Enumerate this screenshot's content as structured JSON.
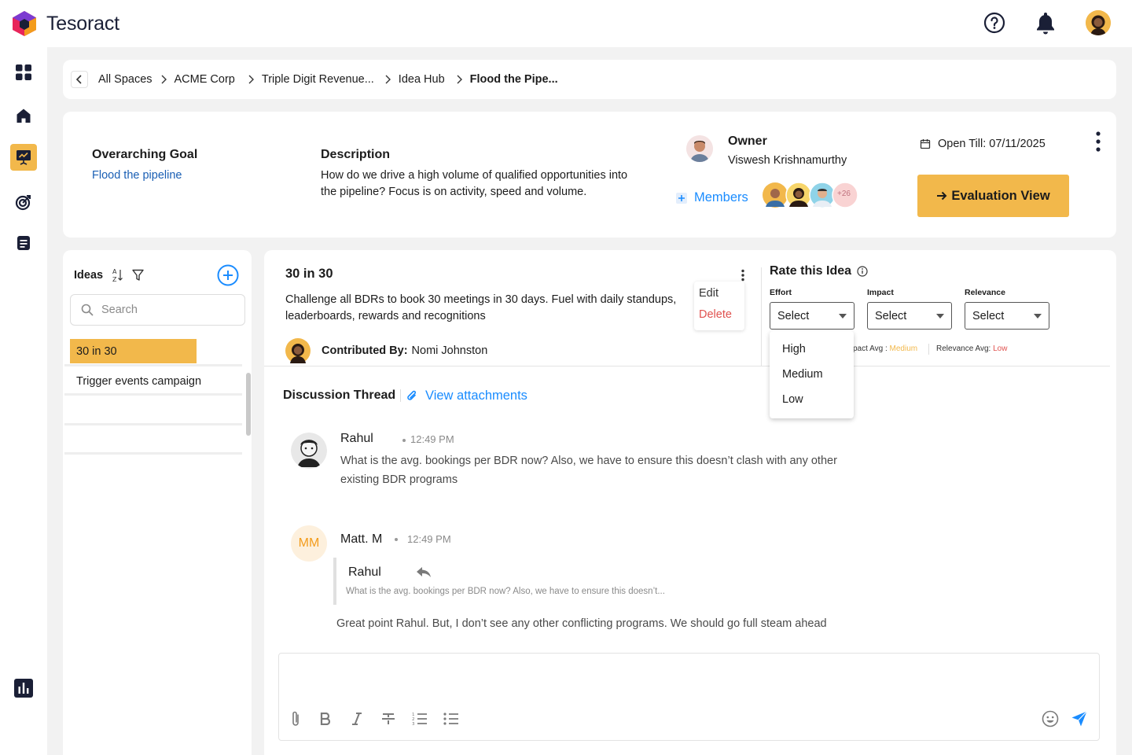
{
  "app": {
    "name": "Tesoract"
  },
  "breadcrumb": {
    "items": [
      "All Spaces",
      "ACME Corp",
      "Triple Digit Revenue...",
      "Idea Hub",
      "Flood the Pipe..."
    ]
  },
  "goal": {
    "goal_label": "Overarching Goal",
    "goal_value": "Flood the pipeline",
    "desc_label": "Description",
    "desc_value": "How do we drive a high volume of qualified opportunities into the pipeline? Focus is on activity, speed and volume.",
    "owner_label": "Owner",
    "owner_name": "Viswesh Krishnamurthy",
    "members_label": "Members",
    "members_more": "+26",
    "open_till": "Open Till: 07/11/2025",
    "eval_button": "Evaluation View"
  },
  "ideas": {
    "title": "Ideas",
    "search_placeholder": "Search",
    "items": [
      {
        "label": "30 in 30"
      },
      {
        "label": "Trigger events campaign"
      }
    ]
  },
  "idea": {
    "title": "30 in 30",
    "description": "Challenge all BDRs to book 30 meetings in 30 days. Fuel with daily standups, leaderboards, rewards and recognitions",
    "contributed_label": "Contributed By:",
    "contributor": "Nomi Johnston",
    "menu": {
      "edit": "Edit",
      "delete": "Delete"
    }
  },
  "rating": {
    "title": "Rate this Idea",
    "effort_label": "Effort",
    "impact_label": "Impact",
    "relevance_label": "Relevance",
    "select_value": "Select",
    "impact_avg_label": "pact Avg :",
    "impact_avg_value": "Medium",
    "relevance_avg_label": "Relevance Avg:",
    "relevance_avg_value": "Low",
    "options": [
      "High",
      "Medium",
      "Low"
    ]
  },
  "discussion": {
    "title": "Discussion Thread",
    "attachments": "View attachments",
    "messages": [
      {
        "author": "Rahul",
        "time": "12:49 PM",
        "text_line1": "What is the avg. bookings per BDR now? Also, we have to ensure this doesn’t clash with any other",
        "text_line2": "existing BDR programs"
      },
      {
        "author": "Matt. M",
        "initials": "MM",
        "time": "12:49 PM",
        "quote_author": "Rahul",
        "quote_text": "What is the avg. bookings per BDR now? Also, we have to ensure this doesn’t...",
        "text": "Great point Rahul. But, I don’t see any other conflicting programs. We should go full steam ahead"
      }
    ]
  },
  "colors": {
    "accent": "#f2b84b",
    "link": "#1a5fb4",
    "danger": "#e0524f",
    "send": "#1a8cff"
  }
}
